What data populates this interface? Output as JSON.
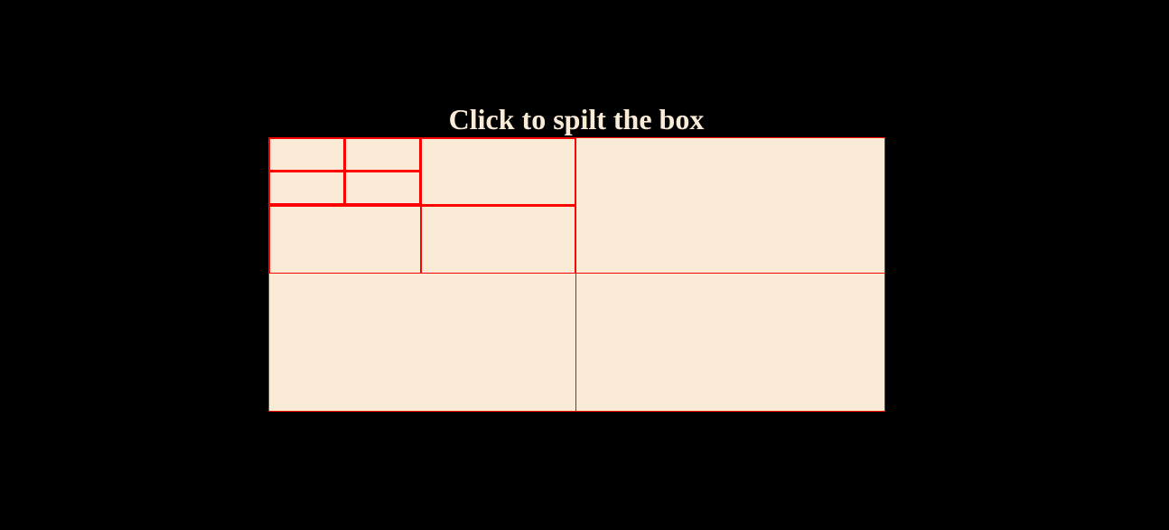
{
  "page": {
    "title": "Click to spilt the box"
  },
  "colors": {
    "background": "#000000",
    "title": "#FAEBD7",
    "box_fill": "#FAEBD7",
    "border": "#FF0000"
  },
  "box": {
    "cells": [
      {
        "id": "q-tl-tl-tl",
        "label": ""
      },
      {
        "id": "q-tl-tl-tr",
        "label": ""
      },
      {
        "id": "q-tl-tl-bl",
        "label": ""
      },
      {
        "id": "q-tl-tl-br",
        "label": ""
      },
      {
        "id": "q-tl-tr",
        "label": ""
      },
      {
        "id": "q-tl-bl",
        "label": ""
      },
      {
        "id": "q-tl-br",
        "label": ""
      },
      {
        "id": "q-tr",
        "label": ""
      },
      {
        "id": "q-bl",
        "label": ""
      },
      {
        "id": "q-br",
        "label": ""
      }
    ]
  }
}
